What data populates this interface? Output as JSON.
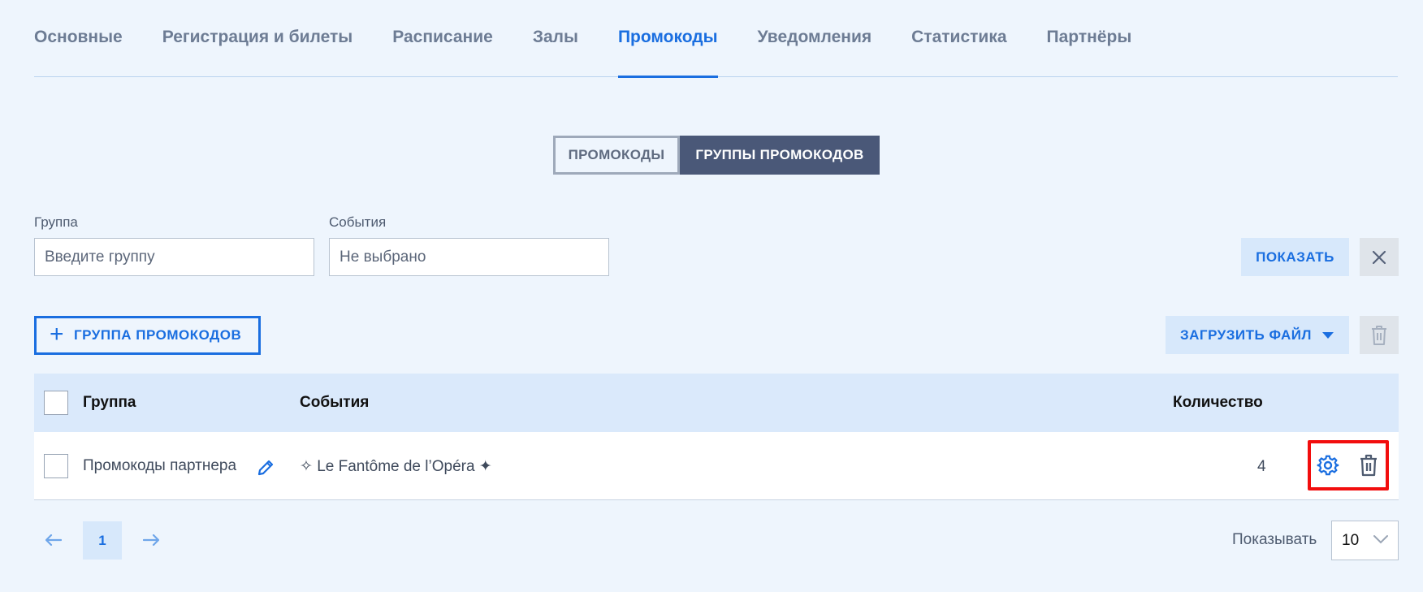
{
  "tabs": [
    {
      "label": "Основные",
      "active": false
    },
    {
      "label": "Регистрация и билеты",
      "active": false
    },
    {
      "label": "Расписание",
      "active": false
    },
    {
      "label": "Залы",
      "active": false
    },
    {
      "label": "Промокоды",
      "active": true
    },
    {
      "label": "Уведомления",
      "active": false
    },
    {
      "label": "Статистика",
      "active": false
    },
    {
      "label": "Партнёры",
      "active": false
    }
  ],
  "segmented": {
    "promocodes": "ПРОМОКОДЫ",
    "groups": "ГРУППЫ ПРОМОКОДОВ",
    "selected": "groups"
  },
  "filters": {
    "group_label": "Группа",
    "group_placeholder": "Введите группу",
    "events_label": "События",
    "events_value": "Не выбрано",
    "show_button": "ПОКАЗАТЬ",
    "clear_icon": "close-icon"
  },
  "actions": {
    "add_group": "ГРУППА ПРОМОКОДОВ",
    "upload_file": "ЗАГРУЗИТЬ ФАЙЛ"
  },
  "table": {
    "headers": {
      "group": "Группа",
      "events": "События",
      "count": "Количество"
    },
    "rows": [
      {
        "group": "Промокоды партнера",
        "events": "✧ Le Fantôme de l’Opéra ✦",
        "count": "4"
      }
    ]
  },
  "pagination": {
    "current_page": "1",
    "show_label": "Показывать",
    "per_page": "10"
  },
  "colors": {
    "accent": "#1a6ee0",
    "background": "#eef5fd",
    "highlight": "#f20d0d",
    "segment_active": "#4a5878"
  }
}
